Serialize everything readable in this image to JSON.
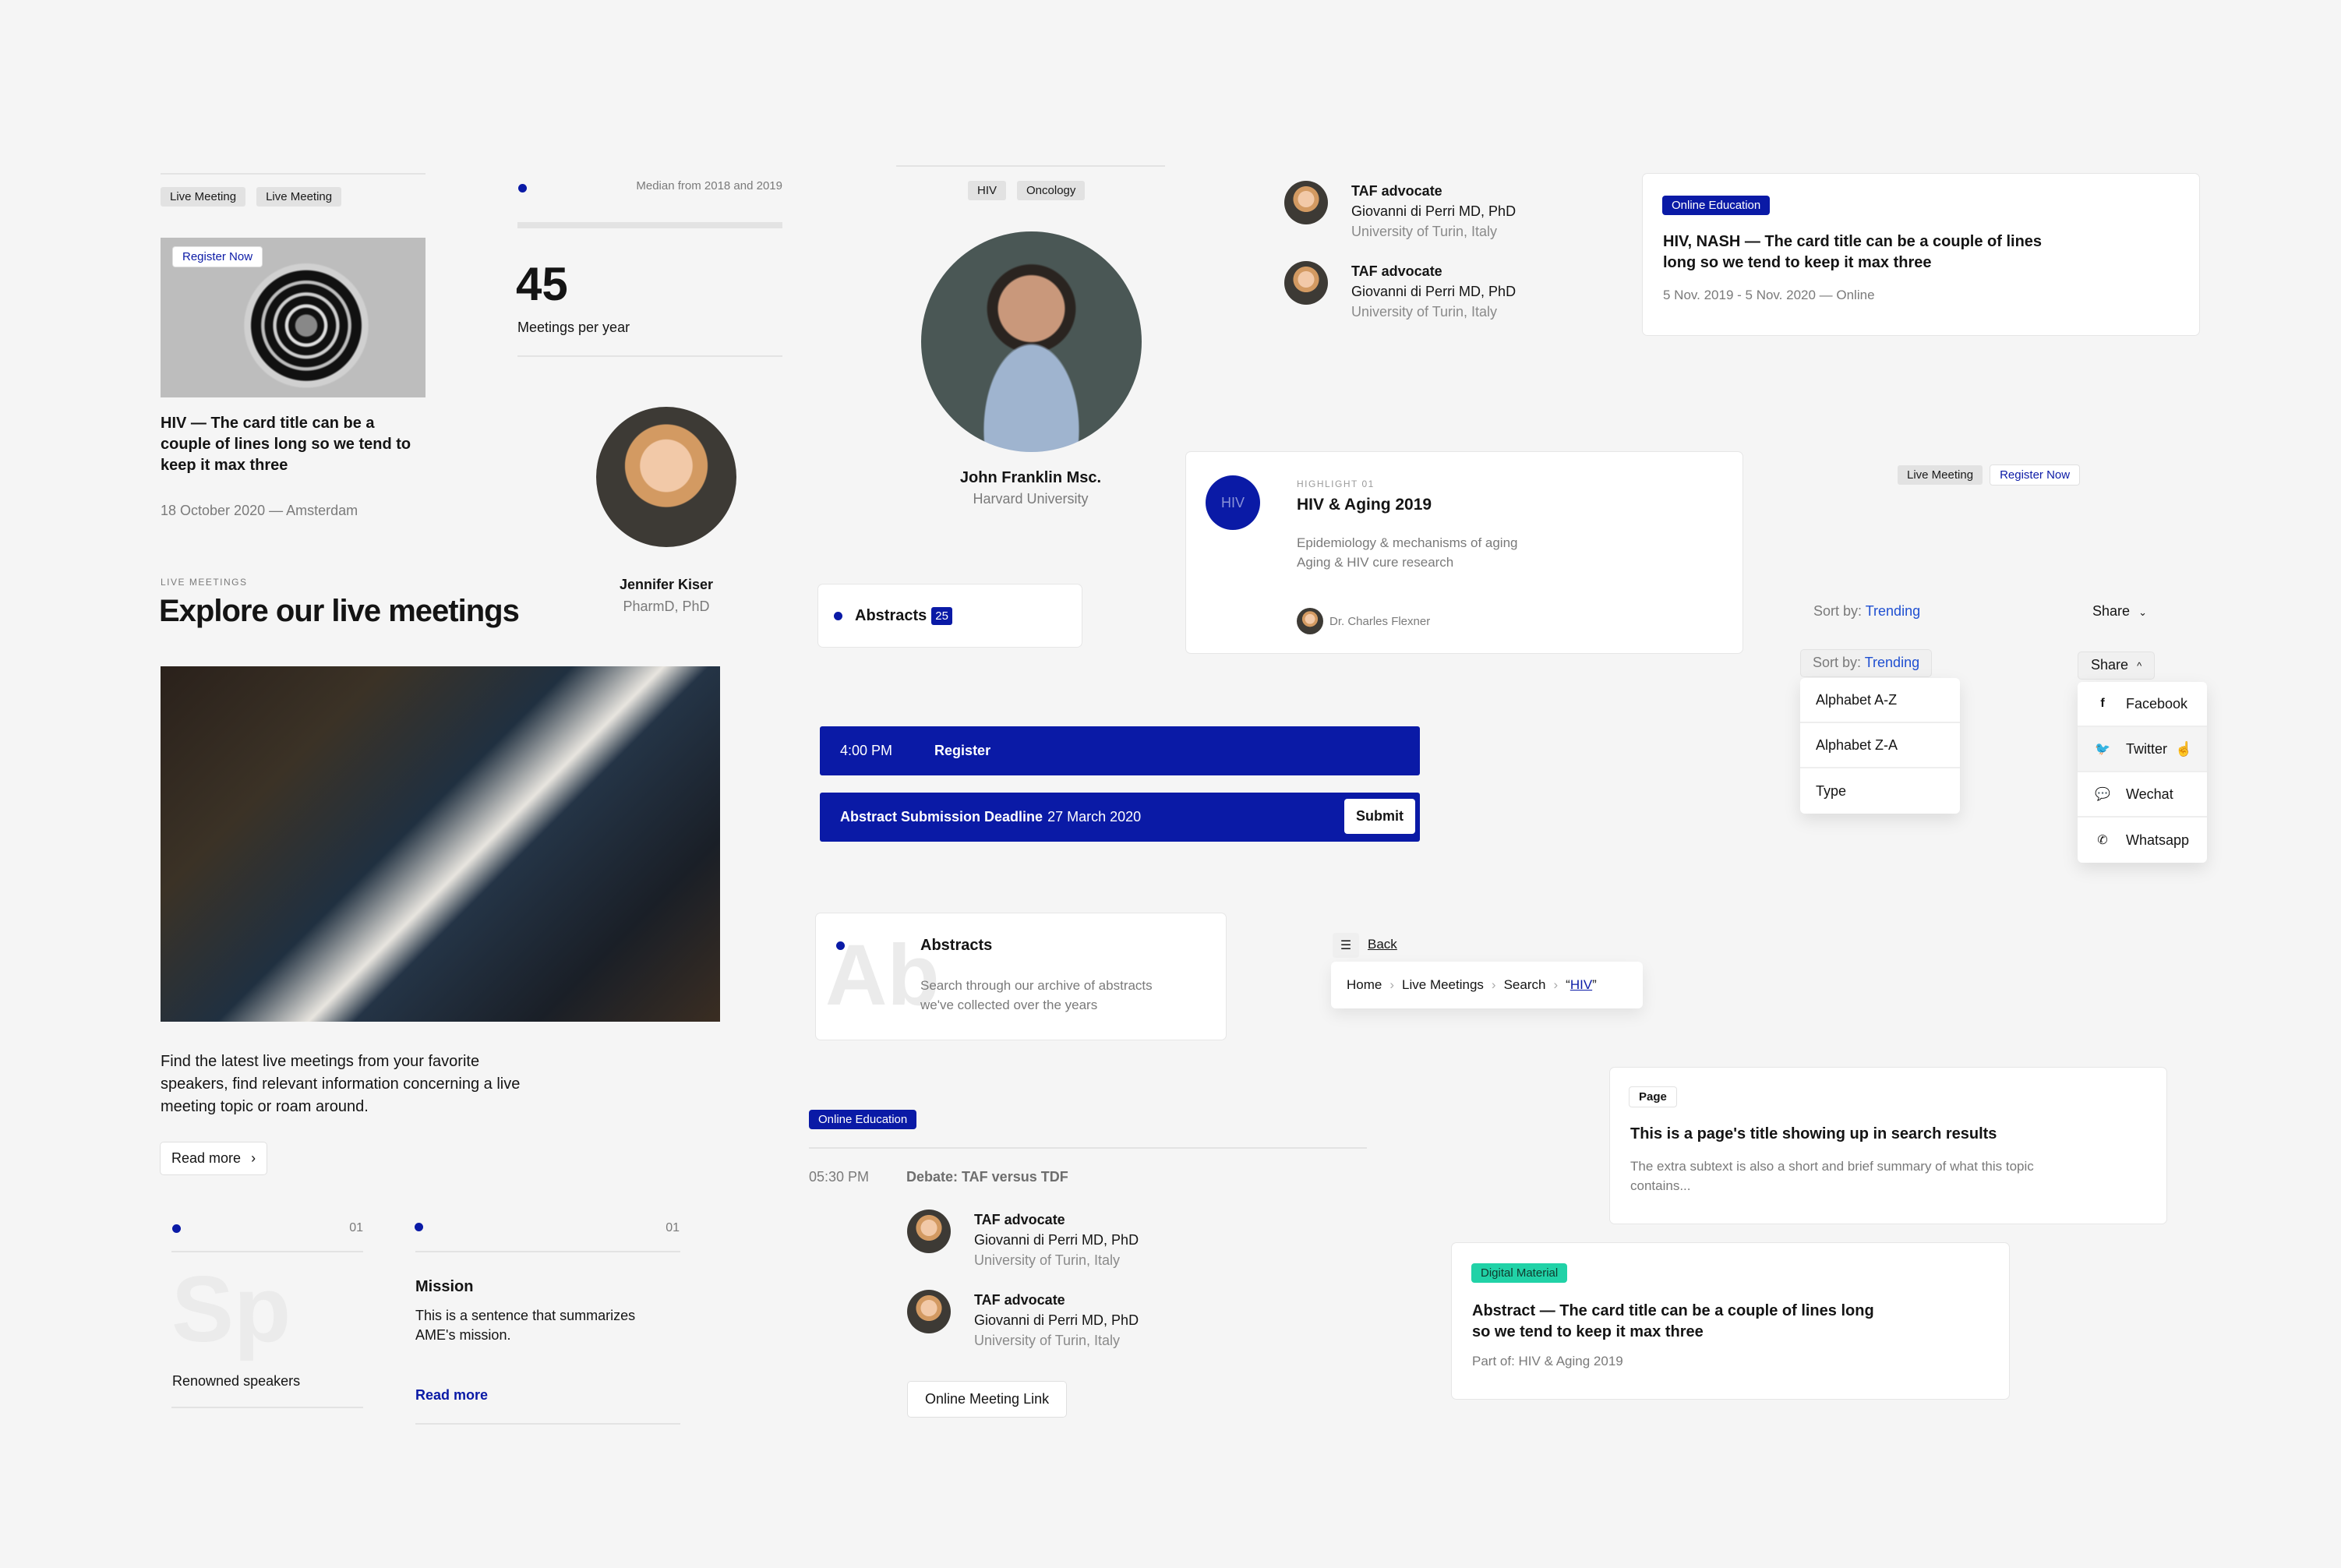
{
  "colors": {
    "accent": "#0a1aa6",
    "link": "#1f4fd1",
    "digital_material": "#21d2a7",
    "background": "#f5f5f5"
  },
  "event_card": {
    "tags": [
      "Live Meeting",
      "Live Meeting"
    ],
    "image_badge": "Register Now",
    "title": "HIV — The card title can be a couple of lines long so we tend to keep it max three",
    "meta": "18 October 2020 — Amsterdam"
  },
  "stat": {
    "caption": "Median from 2018 and 2019",
    "value": "45",
    "label": "Meetings per year"
  },
  "speaker_small": {
    "name": "Jennifer Kiser",
    "title": "PharmD, PhD"
  },
  "section": {
    "eyebrow": "LIVE MEETINGS",
    "heading": "Explore our live meetings",
    "body": "Find the latest live meetings from your favorite speakers, find relevant information concerning a live meeting topic or roam around.",
    "read_more": "Read more",
    "chevron_icon": "chevron-right-icon"
  },
  "feature_speakers": {
    "index": "01",
    "ghost": "Sp",
    "label": "Renowned speakers"
  },
  "feature_mission": {
    "index": "01",
    "title": "Mission",
    "body": "This is a sentence that summarizes AME's mission.",
    "link": "Read more"
  },
  "speaker_large": {
    "tags": [
      "HIV",
      "Oncology"
    ],
    "name": "John Franklin Msc.",
    "affiliation": "Harvard University"
  },
  "abstracts_counter": {
    "label": "Abstracts",
    "count": "25"
  },
  "register_bar": {
    "time": "4:00 PM",
    "label": "Register"
  },
  "deadline_bar": {
    "label_bold": "Abstract Submission Deadline",
    "date": "27 March 2020",
    "button": "Submit"
  },
  "abstracts_card": {
    "ghost": "Ab",
    "title": "Abstracts",
    "body": "Search through our archive of abstracts we've collected over the years"
  },
  "speakers_list": [
    {
      "role": "TAF advocate",
      "name": "Giovanni di Perri MD, PhD",
      "org": "University of Turin, Italy"
    },
    {
      "role": "TAF advocate",
      "name": "Giovanni di Perri MD, PhD",
      "org": "University of Turin, Italy"
    }
  ],
  "highlight": {
    "avatar_label": "HIV",
    "eyebrow": "HIGHLIGHT 01",
    "title": "HIV & Aging 2019",
    "topics": [
      "Epidemiology & mechanisms of aging",
      "Aging & HIV cure research"
    ],
    "speaker": "Dr. Charles Flexner"
  },
  "online_card": {
    "badge": "Online Education",
    "title": "HIV, NASH — The card title can be a couple of lines long so we tend to keep it max three",
    "meta": "5 Nov. 2019 - 5 Nov. 2020 — Online"
  },
  "tag_pair": {
    "tag": "Live Meeting",
    "cta": "Register Now"
  },
  "sort": {
    "label": "Sort by:",
    "value": "Trending",
    "options": [
      "Alphabet A-Z",
      "Alphabet Z-A",
      "Type"
    ]
  },
  "share": {
    "label": "Share",
    "options": [
      {
        "label": "Facebook",
        "icon": "facebook-icon"
      },
      {
        "label": "Twitter",
        "icon": "twitter-icon"
      },
      {
        "label": "Wechat",
        "icon": "wechat-icon"
      },
      {
        "label": "Whatsapp",
        "icon": "whatsapp-icon"
      }
    ]
  },
  "breadcrumb": {
    "back": "Back",
    "items": [
      "Home",
      "Live Meetings",
      "Search"
    ],
    "current": "HIV"
  },
  "agenda": {
    "badge": "Online Education",
    "time": "05:30 PM",
    "session": "Debate:  TAF versus TDF",
    "speakers": [
      {
        "role": "TAF advocate",
        "name": "Giovanni di Perri MD, PhD",
        "org": "University of Turin, Italy"
      },
      {
        "role": "TAF advocate",
        "name": "Giovanni di Perri MD, PhD",
        "org": "University of Turin, Italy"
      }
    ],
    "link_button": "Online Meeting Link"
  },
  "search_result": {
    "badge": "Page",
    "title": "This is a page's title showing up in search results",
    "body": "The extra subtext is also a short and brief summary of what this topic contains..."
  },
  "digital_card": {
    "badge": "Digital Material",
    "title": "Abstract — The card title can be a couple of lines long so we tend to keep it max three",
    "meta": "Part of: HIV & Aging 2019"
  }
}
